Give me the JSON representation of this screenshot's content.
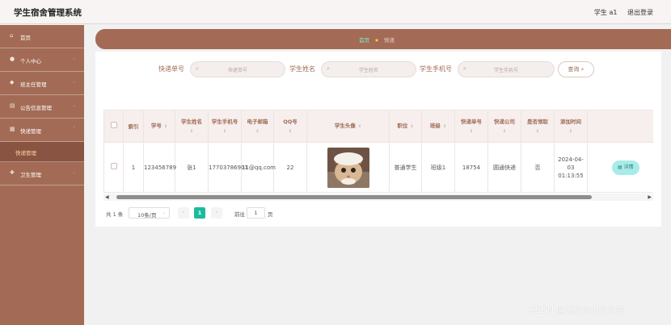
{
  "app": {
    "title": "学生宿舍管理系统"
  },
  "header": {
    "user": "学生 a1",
    "logout": "退出登录"
  },
  "sidebar": {
    "items": [
      {
        "label": "首页",
        "icon": "home-icon"
      },
      {
        "label": "个人中心",
        "icon": "user-icon"
      },
      {
        "label": "班主任管理",
        "icon": "shield-icon"
      },
      {
        "label": "公告信息管理",
        "icon": "notice-icon"
      },
      {
        "label": "快递管理",
        "icon": "package-icon"
      },
      {
        "label": "卫生管理",
        "icon": "health-icon"
      }
    ],
    "active_sub": "快递管理"
  },
  "breadcrumb": {
    "home": "首页",
    "current": "快递"
  },
  "search": {
    "f1_label": "快递单号",
    "f1_ph": "快递单号",
    "f2_label": "学生姓名",
    "f2_ph": "学生姓名",
    "f3_label": "学生手机号",
    "f3_ph": "学生手机号",
    "button": "查询"
  },
  "table": {
    "headers": [
      "索引",
      "学号",
      "学生姓名",
      "学生手机号",
      "电子邮箱",
      "QQ号",
      "学生头像",
      "职位",
      "班级",
      "快递单号",
      "快递公司",
      "是否领取",
      "添加时间",
      "操作"
    ],
    "row": {
      "index": "1",
      "student_id": "123456789",
      "name": "张1",
      "phone": "17703786901",
      "email": "11@qq.com",
      "qq": "22",
      "position": "普通学生",
      "class": "班级1",
      "tracking": "18754",
      "company": "圆通快递",
      "received": "否",
      "added": "2024-04-03 01:13:55",
      "action": "详情"
    }
  },
  "pager": {
    "total": "共 1 条",
    "size": "10条/页",
    "current": "1",
    "goto": "前往",
    "goto_value": "1",
    "unit": "页"
  },
  "watermark": "CSDN @无敌の小さな蚊",
  "colors": {
    "sidebar": "#a36b55",
    "accent": "#1bbc9b",
    "header_text": "#a06a55"
  }
}
